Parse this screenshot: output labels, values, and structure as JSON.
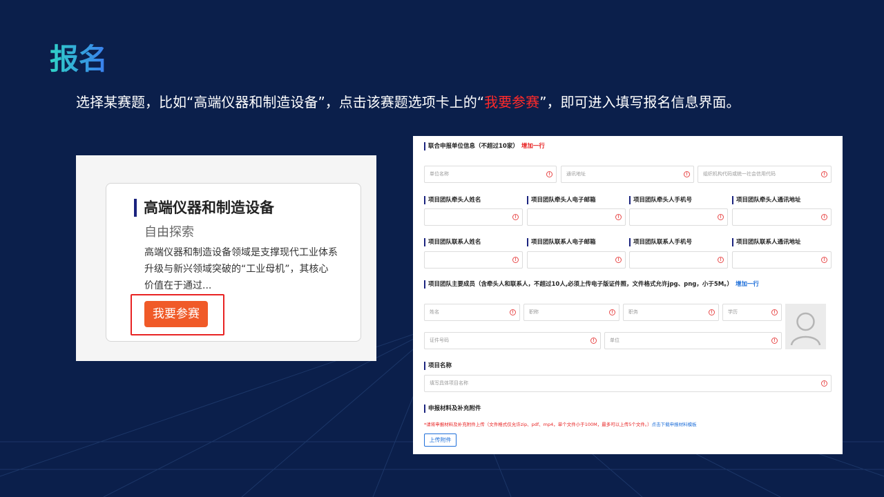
{
  "slide": {
    "title": "报名",
    "desc_part1": "选择某赛题，比如“高端仪器和制造设备”，点击该赛题选项卡上的“",
    "desc_highlight": "我要参赛",
    "desc_part2": "”，即可进入填写报名信息界面。"
  },
  "card": {
    "title": "高端仪器和制造设备",
    "subtitle": "自由探索",
    "description": "高端仪器和制造设备领域是支撑现代工业体系升级与新兴领域突破的“工业母机”，其核心价值在于通过...",
    "join_label": "我要参赛"
  },
  "form": {
    "unit_section": {
      "title": "联合申报单位信息（不超过10家）",
      "add": "增加一行"
    },
    "unit_fields": {
      "name": "单位名称",
      "address": "通讯地址",
      "code": "组织机构代码或统一社会信用代码"
    },
    "leader_labels": {
      "name": "项目团队牵头人姓名",
      "email": "项目团队牵头人电子邮箱",
      "phone": "项目团队牵头人手机号",
      "address": "项目团队牵头人通讯地址"
    },
    "contact_labels": {
      "name": "项目团队联系人姓名",
      "email": "项目团队联系人电子邮箱",
      "phone": "项目团队联系人手机号",
      "address": "项目团队联系人通讯地址"
    },
    "member_section": {
      "title": "项目团队主要成员（含牵头人和联系人，不超过10人,必须上传电子版证件照，文件格式允许jpg、png，小于5M。）",
      "add": "增加一行"
    },
    "member_fields": {
      "name": "姓名",
      "title": "职称",
      "position": "职务",
      "degree": "学历",
      "id": "证件号码",
      "unit": "单位"
    },
    "project_section": {
      "title": "项目名称",
      "placeholder": "填写具体项目名称"
    },
    "material_section": {
      "title": "申报材料及补充附件",
      "notice": "*请将申报材料及补充附件上传（文件格式仅允许zip、pdf、mp4，单个文件小于100M，最多可以上传5个文件。）",
      "link": "点击下载申报材料模板",
      "upload": "上传附件"
    },
    "warn_symbol": "!"
  },
  "colors": {
    "background": "#0b1f4b",
    "highlight": "#ff2a2a",
    "button": "#f05a28",
    "link": "#1e6fd9"
  }
}
